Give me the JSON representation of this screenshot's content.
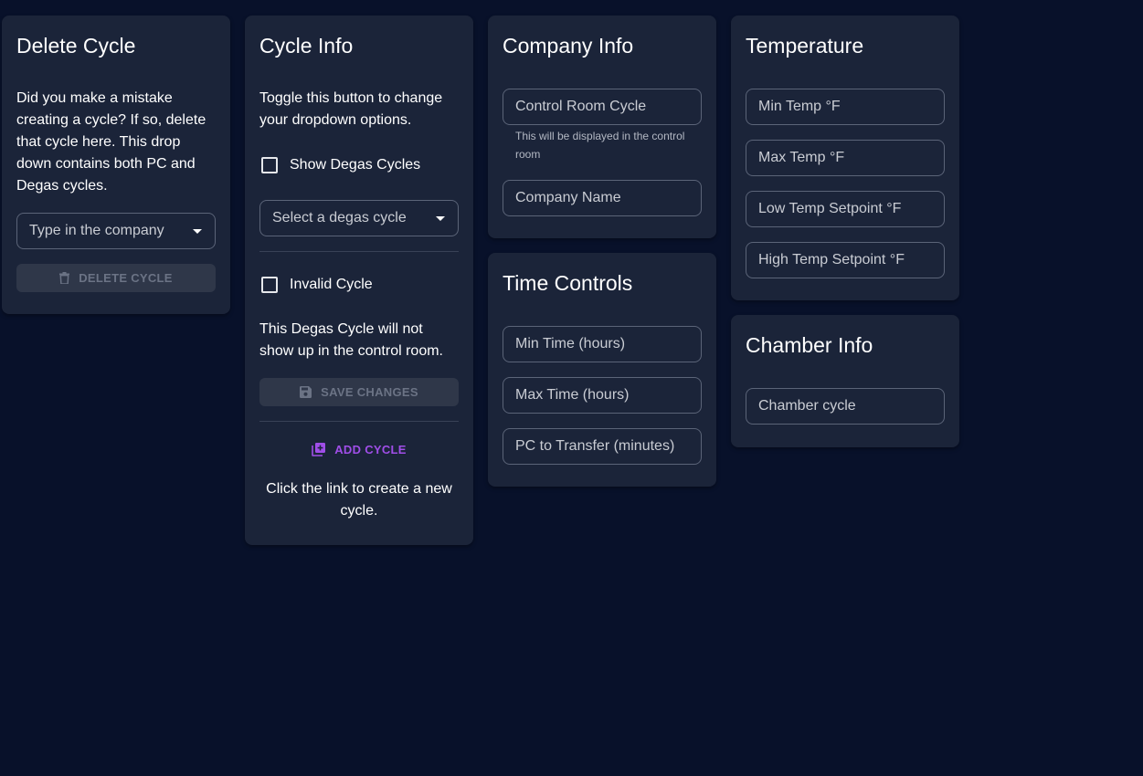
{
  "delete_cycle": {
    "title": "Delete Cycle",
    "description": "Did you make a mistake creating a cycle? If so, delete that cycle here. This drop down contains both PC and Degas cycles.",
    "company_select_placeholder": "Type in the company",
    "delete_button_label": "DELETE CYCLE",
    "delete_icon": "trash-icon"
  },
  "cycle_info": {
    "title": "Cycle Info",
    "description": "Toggle this button to change your dropdown options.",
    "show_degas_label": "Show Degas Cycles",
    "show_degas_checked": false,
    "degas_select_placeholder": "Select a degas cycle",
    "invalid_cycle_label": "Invalid Cycle",
    "invalid_cycle_checked": false,
    "invalid_note": "This Degas Cycle will not show up in the control room.",
    "save_button_label": "SAVE CHANGES",
    "save_icon": "floppy-disk-icon",
    "add_cycle_label": "ADD CYCLE",
    "add_icon": "library-add-icon",
    "add_cycle_note": "Click the link to create a new cycle."
  },
  "company_info": {
    "title": "Company Info",
    "control_room_cycle_placeholder": "Control Room Cycle",
    "control_room_helper": "This will be displayed in the control room",
    "company_name_placeholder": "Company Name"
  },
  "time_controls": {
    "title": "Time Controls",
    "min_time_placeholder": "Min Time (hours)",
    "max_time_placeholder": "Max Time (hours)",
    "pc_transfer_placeholder": "PC to Transfer (minutes)"
  },
  "temperature": {
    "title": "Temperature",
    "min_temp_placeholder": "Min Temp °F",
    "max_temp_placeholder": "Max Temp °F",
    "low_setpoint_placeholder": "Low Temp Setpoint °F",
    "high_setpoint_placeholder": "High Temp Setpoint °F"
  },
  "chamber_info": {
    "title": "Chamber Info",
    "chamber_cycle_placeholder": "Chamber cycle"
  },
  "colors": {
    "background": "#08112a",
    "card": "#1b2439",
    "accent": "#a04ee8",
    "disabled_text": "#6b7385"
  }
}
